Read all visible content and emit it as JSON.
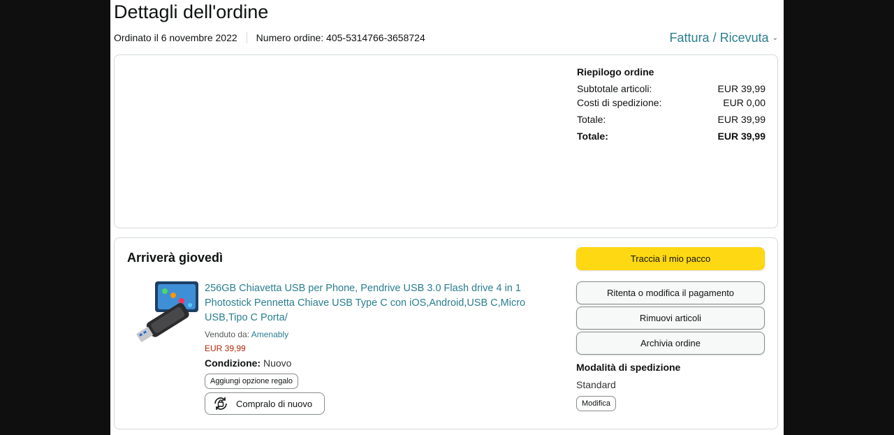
{
  "header": {
    "title": "Dettagli dell'ordine",
    "ordered_on": "Ordinato il 6 novembre 2022",
    "order_number": "Numero ordine: 405-5314766-3658724",
    "invoice_link": "Fattura / Ricevuta"
  },
  "summary": {
    "heading": "Riepilogo ordine",
    "rows": [
      {
        "label": "Subtotale articoli:",
        "value": "EUR 39,99"
      },
      {
        "label": "Costi di spedizione:",
        "value": "EUR 0,00"
      },
      {
        "label": "Totale:",
        "value": "EUR 39,99"
      },
      {
        "label": "Totale:",
        "value": "EUR 39,99"
      }
    ]
  },
  "shipment": {
    "arrival": "Arriverà giovedì",
    "product": {
      "title": "256GB Chiavetta USB per Phone, Pendrive USB 3.0 Flash drive 4 in 1 Photostick Pennetta Chiave USB Type C con iOS,Android,USB C,Micro USB,Tipo C Porta/",
      "sold_by_label": "Venduto da:",
      "seller": "Amenably",
      "price": "EUR 39,99",
      "condition_label": "Condizione:",
      "condition_value": "Nuovo",
      "gift_button": "Aggiungi opzione regalo",
      "buy_again_button": "Compralo di nuovo"
    },
    "actions": {
      "track": "Traccia il mio pacco",
      "retry_payment": "Ritenta o modifica il pagamento",
      "remove_items": "Rimuovi articoli",
      "archive": "Archivia ordine"
    },
    "shipping": {
      "heading": "Modalità di spedizione",
      "value": "Standard",
      "modify": "Modifica"
    }
  },
  "colors": {
    "link": "#2a7e8f",
    "price": "#b12704",
    "primary_button": "#ffd814"
  }
}
